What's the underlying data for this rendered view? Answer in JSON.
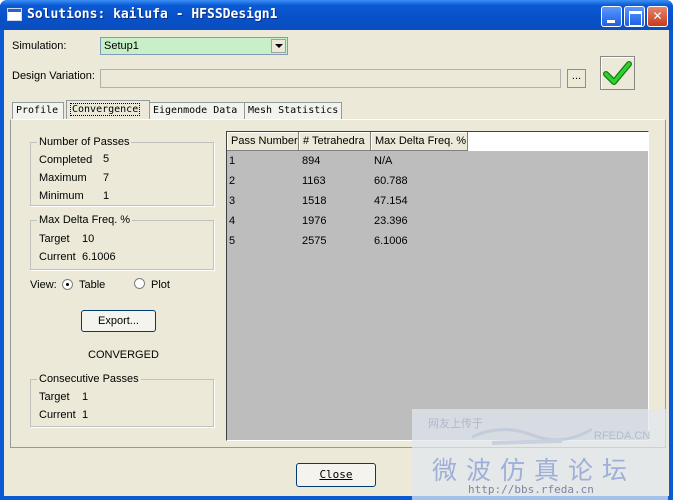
{
  "window": {
    "title": "Solutions: kailufa - HFSSDesign1"
  },
  "simulation": {
    "label": "Simulation:",
    "value": "Setup1"
  },
  "design_variation": {
    "label": "Design Variation:",
    "value": "",
    "browse_label": "..."
  },
  "tabs": [
    {
      "label": "Profile"
    },
    {
      "label": "Convergence"
    },
    {
      "label": "Eigenmode Data"
    },
    {
      "label": "Mesh Statistics"
    }
  ],
  "number_of_passes": {
    "title": "Number of Passes",
    "completed_label": "Completed",
    "completed_value": "5",
    "maximum_label": "Maximum",
    "maximum_value": "7",
    "minimum_label": "Minimum",
    "minimum_value": "1"
  },
  "max_delta": {
    "title": "Max Delta Freq. %",
    "target_label": "Target",
    "target_value": "10",
    "current_label": "Current",
    "current_value": "6.1006"
  },
  "view": {
    "label": "View:",
    "table_label": "Table",
    "plot_label": "Plot",
    "selected": "Table"
  },
  "export_label": "Export...",
  "status": "CONVERGED",
  "consecutive_passes": {
    "title": "Consecutive Passes",
    "target_label": "Target",
    "target_value": "1",
    "current_label": "Current",
    "current_value": "1"
  },
  "table": {
    "headers": [
      "Pass Number",
      "# Tetrahedra",
      "Max Delta Freq. %"
    ],
    "rows": [
      [
        "1",
        "894",
        "N/A"
      ],
      [
        "2",
        "1163",
        "60.788"
      ],
      [
        "3",
        "1518",
        "47.154"
      ],
      [
        "4",
        "1976",
        "23.396"
      ],
      [
        "5",
        "2575",
        "6.1006"
      ]
    ]
  },
  "close_label": "Close",
  "watermark": {
    "top_text": "网友上传于",
    "brand": "RFEDA.CN",
    "chinese": "微波仿真论坛",
    "url": "http://bbs.rfeda.cn"
  },
  "icons": [
    "app-window-icon",
    "minimize-icon",
    "maximize-icon",
    "close-icon",
    "dropdown-arrow-icon",
    "green-checkmark-icon"
  ],
  "colors": {
    "title_bar": "#0a5ad4",
    "combo_bg": "#c8f0c8",
    "check": "#1eb41e",
    "table_bg": "#bdbdbd"
  }
}
